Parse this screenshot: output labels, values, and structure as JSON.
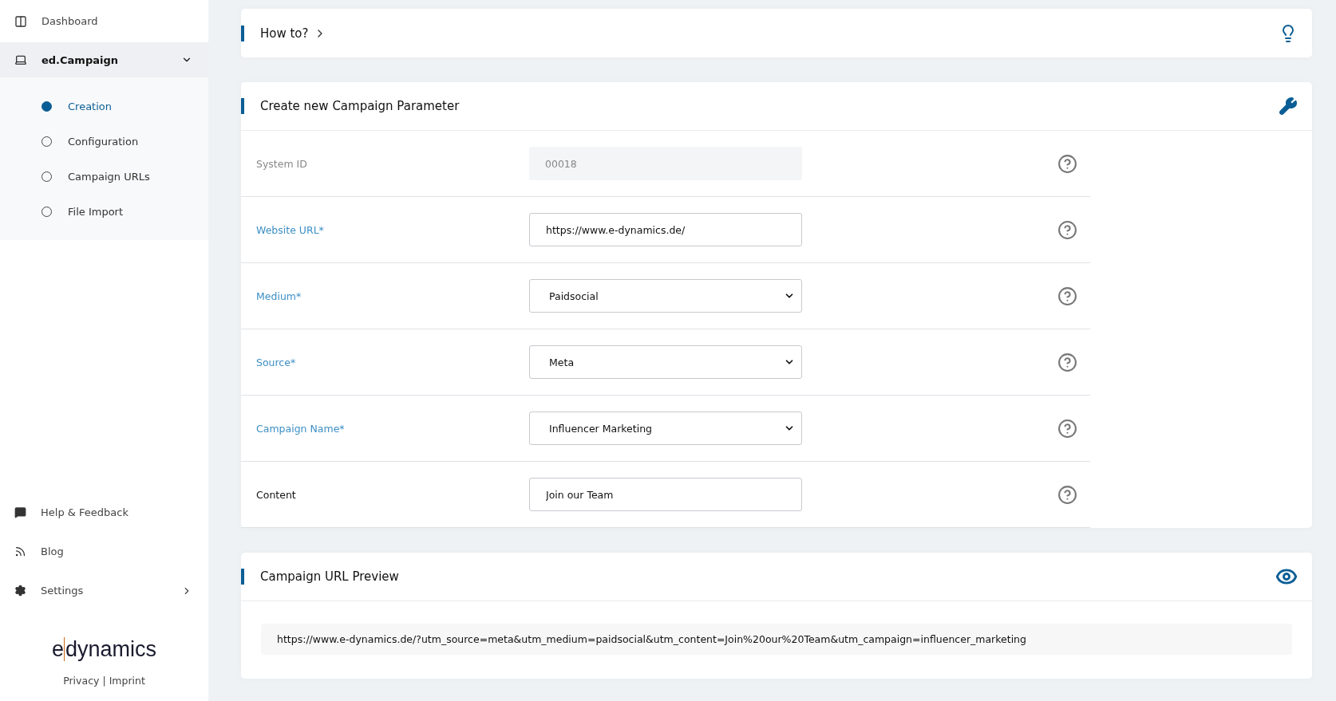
{
  "sidebar": {
    "nav_top": [
      {
        "label": "Dashboard",
        "selected": false
      },
      {
        "label": "ed.Campaign",
        "selected": true,
        "expanded": true,
        "children": [
          {
            "label": "Creation",
            "selected": true
          },
          {
            "label": "Configuration",
            "selected": false
          },
          {
            "label": "Campaign URLs",
            "selected": false
          },
          {
            "label": "File Import",
            "selected": false
          }
        ]
      }
    ],
    "nav_bottom": [
      {
        "label": "Help & Feedback"
      },
      {
        "label": "Blog"
      },
      {
        "label": "Settings",
        "expanded": false
      }
    ],
    "logo": {
      "left": "e",
      "right": "dynamics"
    },
    "footer_links": [
      "Privacy",
      "Imprint"
    ],
    "footer_separator": "|"
  },
  "how_to": {
    "title": "How to?"
  },
  "form": {
    "title": "Create new Campaign Parameter",
    "fields": [
      {
        "label": "System ID",
        "kind": "readonly",
        "required": false,
        "value": "00018"
      },
      {
        "label": "Website URL*",
        "kind": "text",
        "required": true,
        "value": "https://www.e-dynamics.de/"
      },
      {
        "label": "Medium*",
        "kind": "select",
        "required": true,
        "value": "Paidsocial"
      },
      {
        "label": "Source*",
        "kind": "select",
        "required": true,
        "value": "Meta"
      },
      {
        "label": "Campaign Name*",
        "kind": "select",
        "required": true,
        "value": "Influencer Marketing"
      },
      {
        "label": "Content",
        "kind": "text",
        "required": false,
        "value": "Join our Team"
      }
    ]
  },
  "preview": {
    "title": "Campaign URL Preview",
    "url": "https://www.e-dynamics.de/?utm_source=meta&utm_medium=paidsocial&utm_content=Join%20our%20Team&utm_campaign=influencer_marketing"
  }
}
